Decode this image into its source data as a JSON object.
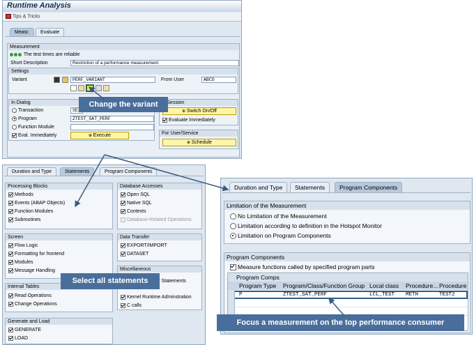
{
  "window1": {
    "title": "Runtime Analysis",
    "tips": "Tips & Tricks",
    "tabs": [
      "Measr.",
      "Evaluate"
    ],
    "measurement_header": "Measurement",
    "status": "The test times are reliable",
    "short_desc_label": "Short Description",
    "short_desc_value": "Restriction of a performance measurement",
    "settings_header": "Settings",
    "variant_label": "Variant",
    "variant_value": "PERF_VARIANT",
    "from_user_label": "From User",
    "from_user_value": "ABCD",
    "in_dialog_header": "In Dialog",
    "transaction_label": "Transaction",
    "transaction_value": "SE3",
    "program_label": "Program",
    "program_value": "ZTEST_SAT_PERF",
    "function_module_label": "Function Module",
    "eval_label": "Eval. Immediately",
    "execute_label": "Execute",
    "parallel_session_header": "el Session",
    "switch_label": "Switch On/Off",
    "evaluate_immediately_label": "Evaluate Immediately",
    "user_service_header": "For User/Service",
    "schedule_label": "Schedule"
  },
  "window2": {
    "tabs": [
      "Duration and Type",
      "Statements",
      "Program Components"
    ],
    "processing_blocks": {
      "header": "Processing Blocks",
      "items": [
        "Methods",
        "Events (ABAP Objects)",
        "Function Modules",
        "Subroutines"
      ]
    },
    "database_accesses": {
      "header": "Database Accesses",
      "items": [
        "Open SQL",
        "Native SQL",
        "Contexts",
        "Database-Related Operations"
      ]
    },
    "screen": {
      "header": "Screen",
      "items": [
        "Flow Logic",
        "Formatting for frontend",
        "Modules",
        "Message Handling"
      ]
    },
    "data_transfer": {
      "header": "Data Transfer",
      "items": [
        "EXPORT/IMPORT",
        "DATASET"
      ]
    },
    "miscellaneous": {
      "header": "Miscellaneous",
      "partial": "P Statements",
      "items": [
        "Kernel Runtime Adminstration",
        "C calls"
      ]
    },
    "internal_tables": {
      "header": "Internal Tables",
      "items": [
        "Read Operations",
        "Change Operations"
      ]
    },
    "generate_load": {
      "header": "Generate and Load",
      "items": [
        "GENERATE",
        "LOAD"
      ]
    }
  },
  "window3": {
    "tabs": [
      "Duration and Type",
      "Statements",
      "Program Components"
    ],
    "limitation_header": "Limitation of the Measurement",
    "options": [
      "No Limitation of the Measurement",
      "Limitation according to definition in the Hotspot Monitor",
      "Limitation on Program Components"
    ],
    "components_header": "Program Components",
    "measure_label": "Measure functions called by specified program parts",
    "comps_header": "Program Comps",
    "columns": [
      "Program Type",
      "Program/Class/Function Group",
      "Local class",
      "Procedure...",
      "Procedure"
    ],
    "row": [
      "P",
      "ZTEST_SAT_PERF",
      "LCL_TEST",
      "METH",
      "TEST2"
    ]
  },
  "callouts": {
    "change_variant": "Change the variant",
    "select_all": "Select all statements",
    "focus": "Focus a measurement on the top performance consumer"
  },
  "colors": {
    "callout_bg": "#4a6e9b",
    "button_bg": "#fff5a8",
    "frame_bg": "#dfe7f0",
    "group_header": "#d7e1ec"
  }
}
